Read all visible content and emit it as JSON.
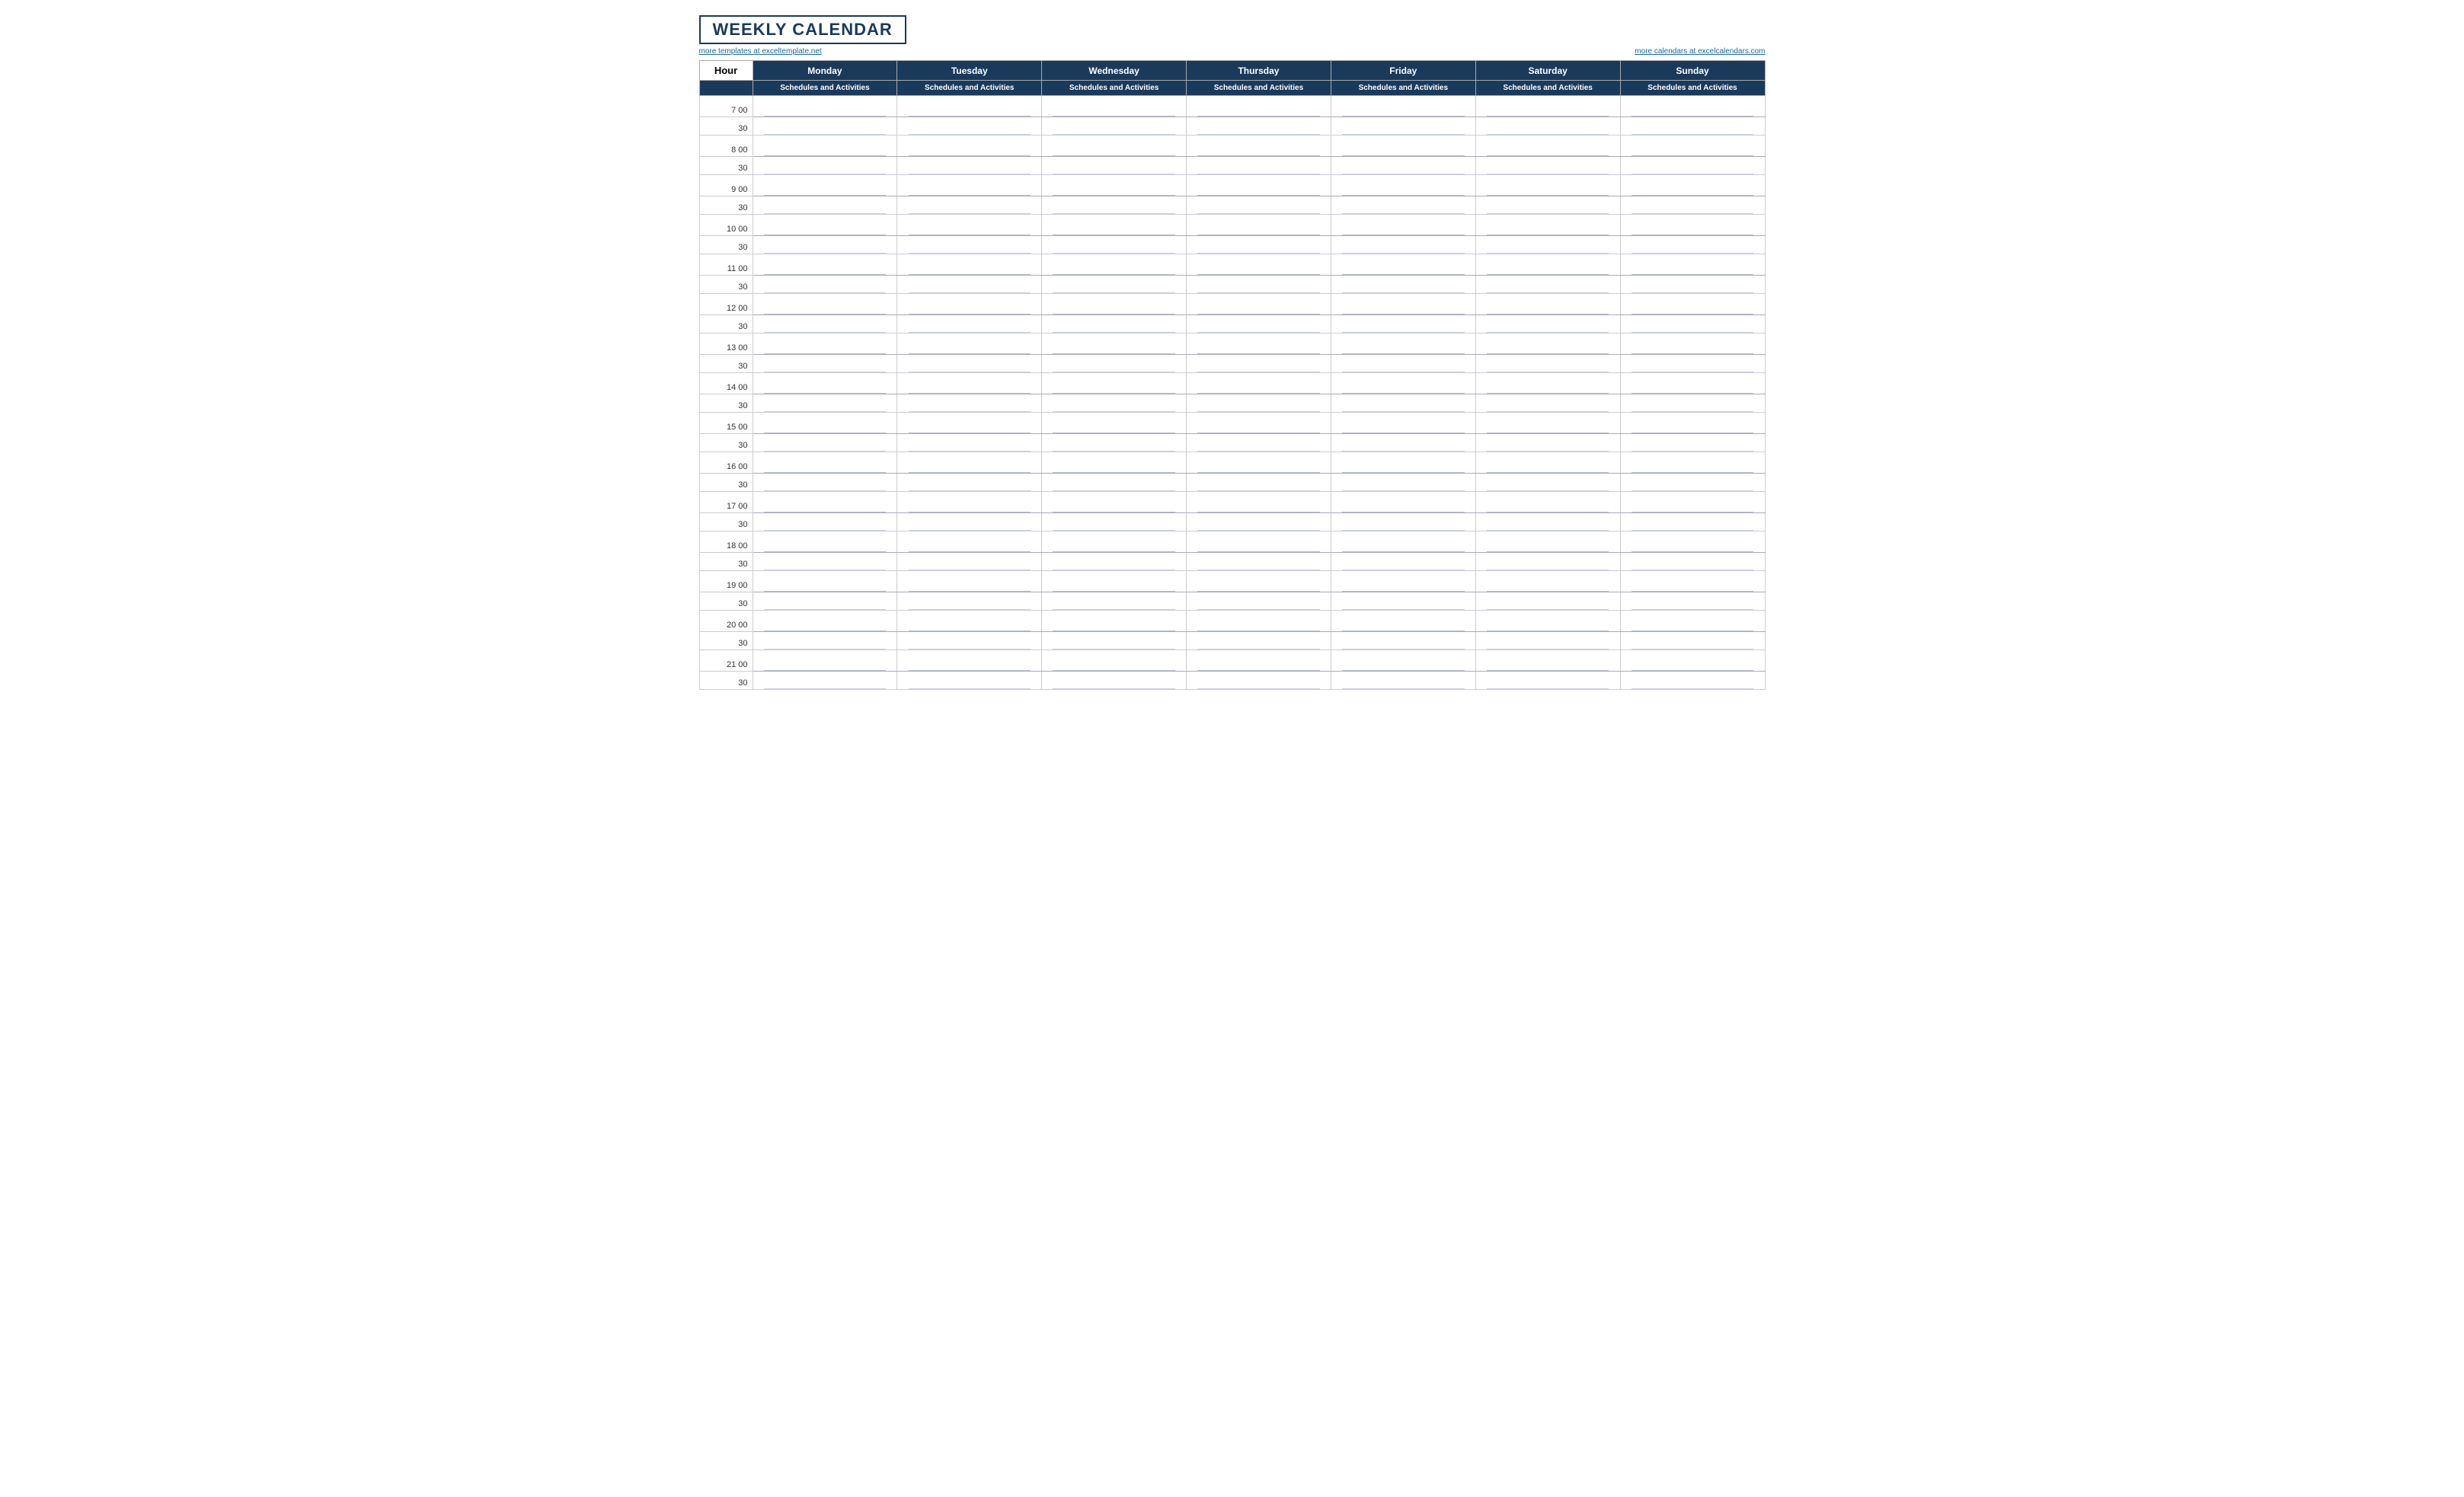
{
  "title": "WEEKLY CALENDAR",
  "links": {
    "left": "more templates at exceltemplate.net",
    "right": "more calendars at excelcalendars.com"
  },
  "columns": {
    "hour": "Hour",
    "days": [
      "Monday",
      "Tuesday",
      "Wednesday",
      "Thursday",
      "Friday",
      "Saturday",
      "Sunday"
    ]
  },
  "sub_header": "Schedules and Activities",
  "hours": [
    {
      "label": "7  00",
      "type": "full"
    },
    {
      "label": "30",
      "type": "half"
    },
    {
      "label": "8  00",
      "type": "full"
    },
    {
      "label": "30",
      "type": "half"
    },
    {
      "label": "9  00",
      "type": "full"
    },
    {
      "label": "30",
      "type": "half"
    },
    {
      "label": "10  00",
      "type": "full"
    },
    {
      "label": "30",
      "type": "half"
    },
    {
      "label": "11  00",
      "type": "full"
    },
    {
      "label": "30",
      "type": "half"
    },
    {
      "label": "12  00",
      "type": "full"
    },
    {
      "label": "30",
      "type": "half"
    },
    {
      "label": "13  00",
      "type": "full"
    },
    {
      "label": "30",
      "type": "half"
    },
    {
      "label": "14  00",
      "type": "full"
    },
    {
      "label": "30",
      "type": "half"
    },
    {
      "label": "15  00",
      "type": "full"
    },
    {
      "label": "30",
      "type": "half"
    },
    {
      "label": "16  00",
      "type": "full"
    },
    {
      "label": "30",
      "type": "half"
    },
    {
      "label": "17  00",
      "type": "full"
    },
    {
      "label": "30",
      "type": "half"
    },
    {
      "label": "18  00",
      "type": "full"
    },
    {
      "label": "30",
      "type": "half"
    },
    {
      "label": "19  00",
      "type": "full"
    },
    {
      "label": "30",
      "type": "half"
    },
    {
      "label": "20  00",
      "type": "full"
    },
    {
      "label": "30",
      "type": "half"
    },
    {
      "label": "21  00",
      "type": "full"
    },
    {
      "label": "30",
      "type": "half"
    }
  ]
}
